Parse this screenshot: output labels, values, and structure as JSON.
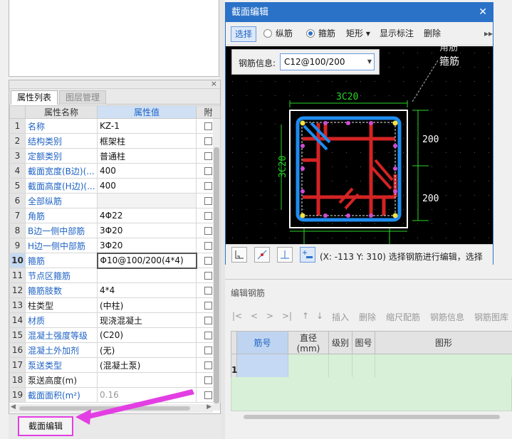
{
  "property_panel": {
    "tabs": [
      "属性列表",
      "图层管理"
    ],
    "headers": [
      "属性名称",
      "属性值",
      "附"
    ],
    "close_glyph": "×",
    "rows": [
      {
        "n": "1",
        "name": "名称",
        "value": "KZ-1"
      },
      {
        "n": "2",
        "name": "结构类别",
        "value": "框架柱"
      },
      {
        "n": "3",
        "name": "定额类别",
        "value": "普通柱"
      },
      {
        "n": "4",
        "name": "截面宽度(B边)(...",
        "value": "400"
      },
      {
        "n": "5",
        "name": "截面高度(H边)(...",
        "value": "400"
      },
      {
        "n": "6",
        "name": "全部纵筋",
        "value": ""
      },
      {
        "n": "7",
        "name": "角筋",
        "value": "4Φ22"
      },
      {
        "n": "8",
        "name": "B边一侧中部筋",
        "value": "3Φ20"
      },
      {
        "n": "9",
        "name": "H边一侧中部筋",
        "value": "3Φ20"
      },
      {
        "n": "10",
        "name": "箍筋",
        "value": "Φ10@100/200(4*4)"
      },
      {
        "n": "11",
        "name": "节点区箍筋",
        "value": ""
      },
      {
        "n": "12",
        "name": "箍筋肢数",
        "value": "4*4"
      },
      {
        "n": "13",
        "name": "柱类型",
        "value": "(中柱)"
      },
      {
        "n": "14",
        "name": "材质",
        "value": "现浇混凝土"
      },
      {
        "n": "15",
        "name": "混凝土强度等级",
        "value": "(C20)"
      },
      {
        "n": "16",
        "name": "混凝土外加剂",
        "value": "(无)"
      },
      {
        "n": "17",
        "name": "泵送类型",
        "value": "(混凝土泵)"
      },
      {
        "n": "18",
        "name": "泵送高度(m)",
        "value": ""
      },
      {
        "n": "19",
        "name": "截面面积(m²)",
        "value": "0.16"
      }
    ]
  },
  "section_edit_button": "截面编辑",
  "dialog": {
    "title": "截面编辑",
    "close_glyph": "✕",
    "toolbar": {
      "select": "选择",
      "longitudinal": "纵筋",
      "stirrup": "箍筋",
      "rect": "矩形 ▾",
      "show_label": "显示标注",
      "delete": "删除",
      "more": "▸▸"
    },
    "rebar_info_label": "钢筋信息:",
    "rebar_info_value": "C12@100/200",
    "canvas_labels": {
      "top_rebar": "3C20",
      "left_rebar": "3C20",
      "dim_upper": "200",
      "dim_lower": "200",
      "corner_label": "角筋",
      "stirrup_label": "箍筋"
    },
    "status_text": "(X: -113 Y: 310) 选择钢筋进行编辑，选择"
  },
  "edit_panel": {
    "title": "编辑钢筋",
    "toolbar": [
      "|<",
      "<",
      ">",
      ">|",
      "↑",
      "↓",
      "插入",
      "删除",
      "缩尺配筋",
      "钢筋信息",
      "钢筋图库"
    ],
    "headers": [
      "筋号",
      "直径(mm)",
      "级别",
      "图号",
      "图形"
    ],
    "row_number": "1"
  }
}
